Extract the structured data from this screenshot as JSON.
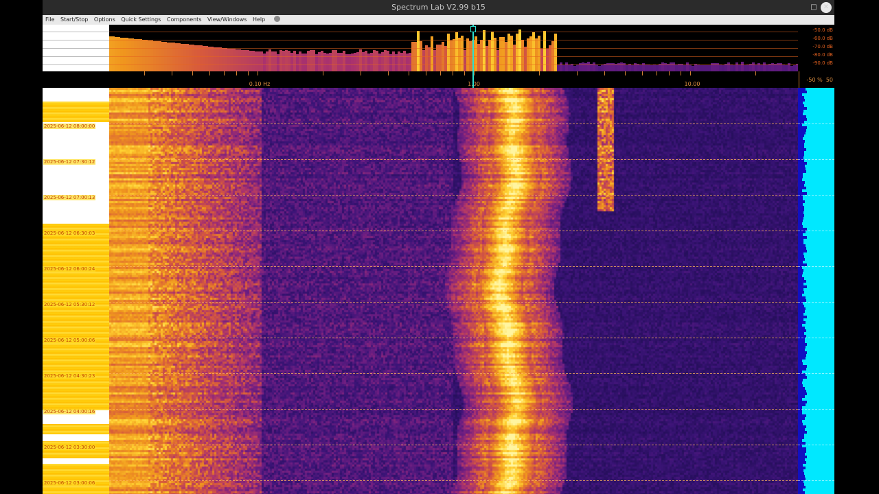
{
  "window": {
    "title": "Spectrum Lab V2.99 b15",
    "maximize_glyph": "□",
    "close_glyph": "✕"
  },
  "menu": [
    "File",
    "Start/Stop",
    "Options",
    "Quick Settings",
    "Components",
    "View/Windows",
    "Help"
  ],
  "spectrum": {
    "db_labels": [
      "-50.0 dB",
      "-60.0 dB",
      "-70.0 dB",
      "-80.0 dB",
      "-90.0 dB"
    ],
    "freq_labels": [
      "0.10 Hz",
      "1.00",
      "10.00"
    ],
    "marker_freq_hz": 1.0
  },
  "side_scale": {
    "label_pct": "-50 %",
    "label_val": "50"
  },
  "waterfall": {
    "time_labels": [
      "2025-06-12 08:00:00",
      "2025-06-12 07:30:12",
      "2025-06-12 07:00:13",
      "2025-06-12 06:30:03",
      "2025-06-12 06:00:24",
      "2025-06-12 05:30:12",
      "2025-06-12 05:00:06",
      "2025-06-12 04:30:23",
      "2025-06-12 04:00:16",
      "2025-06-12 03:30:00",
      "2025-06-12 03:00:06"
    ]
  },
  "colors": {
    "background": "#1c0f54",
    "accent_orange": "#e08a20",
    "hot_yellow": "#ffe45a",
    "cursor_cyan": "#2be0d0",
    "side_cyan": "#00e8ff"
  }
}
